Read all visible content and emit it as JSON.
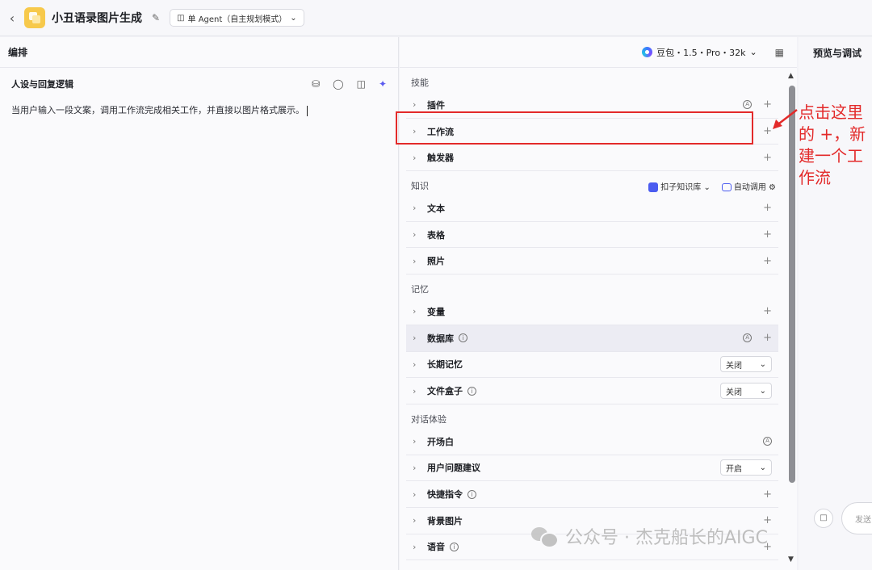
{
  "header": {
    "back_icon": "chevron-left-icon",
    "app_title": "小丑语录图片生成",
    "edit_icon": "edit-icon",
    "agent_mode": "单 Agent（自主规划模式）"
  },
  "left": {
    "section_title": "编排",
    "persona_title": "人设与回复逻辑",
    "persona_text": "当用户输入一段文案，调用工作流完成相关工作，并直接以图片格式展示。"
  },
  "model": {
    "name": "豆包・1.5・Pro・32k"
  },
  "skills": {
    "group_skill": "技能",
    "plugin": "插件",
    "workflow": "工作流",
    "trigger": "触发器",
    "group_knowledge": "知识",
    "kb_source": "扣子知识库",
    "auto_call": "自动调用",
    "text": "文本",
    "table": "表格",
    "photo": "照片",
    "group_memory": "记忆",
    "variable": "变量",
    "database": "数据库",
    "long_memory": "长期记忆",
    "long_memory_value": "关闭",
    "file_box": "文件盒子",
    "file_box_value": "关闭",
    "group_dialog": "对话体验",
    "opening": "开场白",
    "suggestion": "用户问题建议",
    "suggestion_value": "开启",
    "shortcut": "快捷指令",
    "background": "背景图片",
    "voice": "语音"
  },
  "preview": {
    "title": "预览与调试",
    "send_placeholder": "发送"
  },
  "annotation": {
    "text": "点击这里的 +，新建一个工作流",
    "color": "#e32a2a"
  },
  "watermark": {
    "text": "公众号 · 杰克船长的AIGC"
  }
}
